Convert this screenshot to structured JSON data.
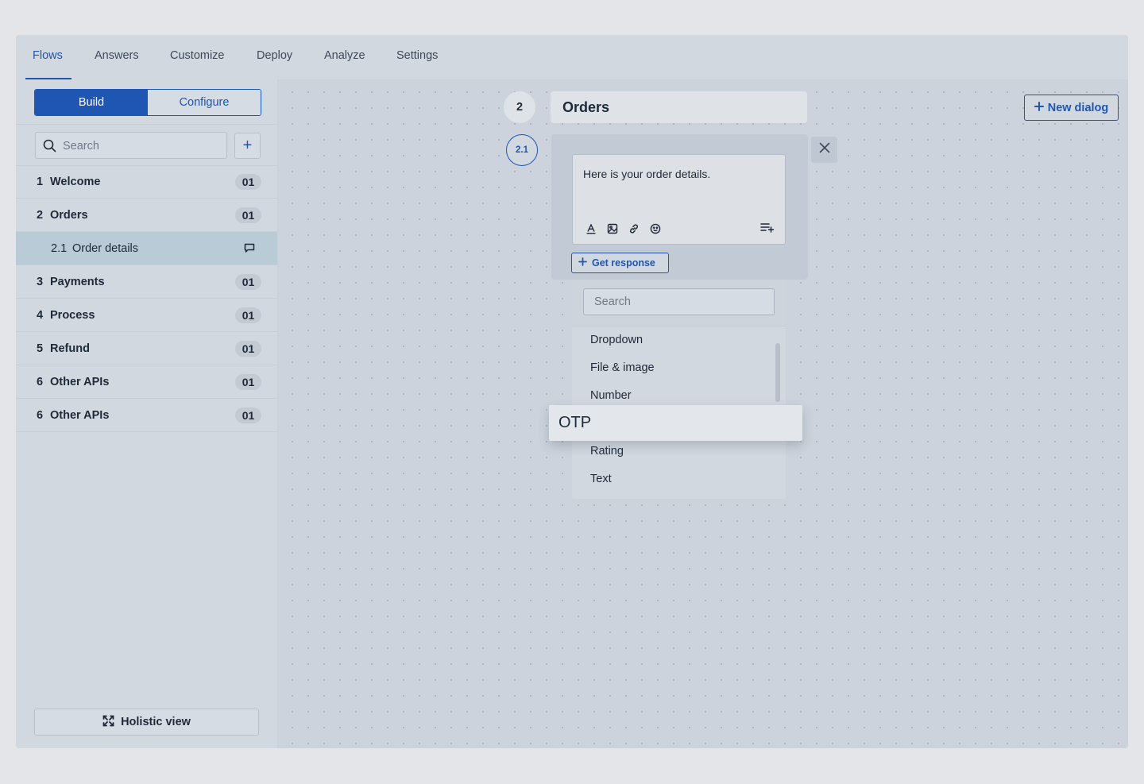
{
  "nav": {
    "tabs": [
      {
        "label": "Flows",
        "active": true
      },
      {
        "label": "Answers",
        "active": false
      },
      {
        "label": "Customize",
        "active": false
      },
      {
        "label": "Deploy",
        "active": false
      },
      {
        "label": "Analyze",
        "active": false
      },
      {
        "label": "Settings",
        "active": false
      }
    ]
  },
  "sidebar": {
    "mode": {
      "build": "Build",
      "configure": "Configure",
      "selected": "Build"
    },
    "search": {
      "placeholder": "Search",
      "value": ""
    },
    "add_icon": "plus-icon",
    "flows": [
      {
        "num": "1",
        "label": "Welcome",
        "badge": "01"
      },
      {
        "num": "2",
        "label": "Orders",
        "badge": "01"
      },
      {
        "num": "2.1",
        "label": "Order details",
        "icon": "message-icon",
        "selected": true
      },
      {
        "num": "3",
        "label": "Payments",
        "badge": "01"
      },
      {
        "num": "4",
        "label": "Process",
        "badge": "01"
      },
      {
        "num": "5",
        "label": "Refund",
        "badge": "01"
      },
      {
        "num": "6",
        "label": "Other APIs",
        "badge": "01"
      },
      {
        "num": "6",
        "label": "Other APIs",
        "badge": "01"
      }
    ],
    "holistic_label": "Holistic view"
  },
  "canvas": {
    "node": {
      "num": "2",
      "title": "Orders"
    },
    "subnode": {
      "num": "2.1",
      "message": "Here is your order details.",
      "format_icons": [
        "text-color-icon",
        "image-icon",
        "link-icon",
        "emoji-icon"
      ],
      "add_line_icon": "add-list-icon",
      "get_response_label": "Get response"
    },
    "response_dropdown": {
      "search_placeholder": "Search",
      "items": [
        "Dropdown",
        "File & image",
        "Number",
        "Rating",
        "Text"
      ],
      "dragging_item": "OTP"
    },
    "new_dialog_label": "New dialog"
  },
  "colors": {
    "accent": "#1f56b3",
    "background": "#d2d8e0",
    "selected_row": "#bacbd8"
  }
}
